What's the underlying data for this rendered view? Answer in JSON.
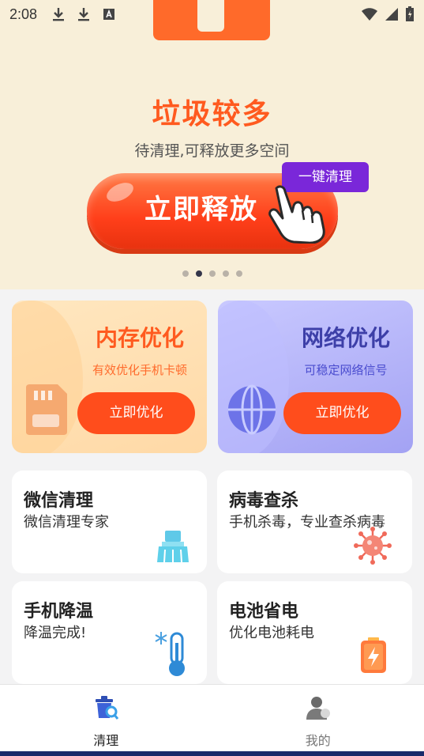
{
  "status_bar": {
    "time": "2:08",
    "icons": [
      "download-icon",
      "download-icon",
      "a-box-icon"
    ],
    "right_icons": [
      "wifi-icon",
      "signal-icon",
      "battery-charging-icon"
    ]
  },
  "banner": {
    "title": "垃圾较多",
    "subtitle": "待清理,可释放更多空间",
    "button_label": "立即释放",
    "badge": "一键清理",
    "pager": {
      "count": 5,
      "active_index": 1
    },
    "colors": {
      "background": "#f8efd9",
      "accent": "#ff5a1f",
      "badge": "#7a27d9"
    }
  },
  "features": {
    "memory": {
      "title": "内存优化",
      "desc": "有效优化手机卡顿",
      "button": "立即优化",
      "icon": "sd-card-icon"
    },
    "network": {
      "title": "网络优化",
      "desc": "可稳定网络信号",
      "button": "立即优化",
      "icon": "globe-icon"
    }
  },
  "tools": [
    {
      "title": "微信清理",
      "desc": "微信清理专家",
      "icon": "broom-icon"
    },
    {
      "title": "病毒查杀",
      "desc": "手机杀毒，专业查杀病毒",
      "icon": "virus-icon"
    },
    {
      "title": "手机降温",
      "desc": "降温完成!",
      "icon": "thermometer-icon"
    },
    {
      "title": "电池省电",
      "desc": "优化电池耗电",
      "icon": "battery-icon"
    }
  ],
  "nav": [
    {
      "label": "清理",
      "icon": "trash-clean-icon",
      "active": true
    },
    {
      "label": "我的",
      "icon": "user-icon",
      "active": false
    }
  ]
}
